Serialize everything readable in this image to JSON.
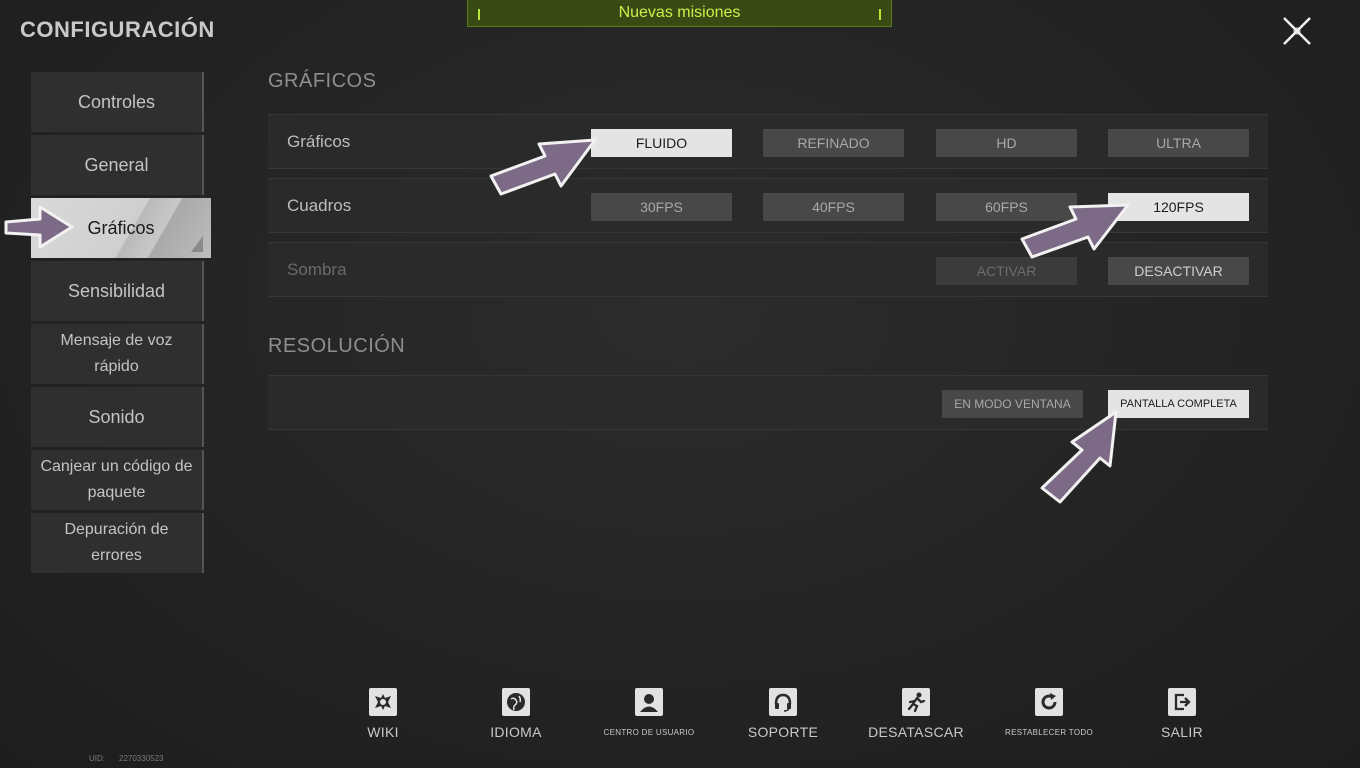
{
  "page": {
    "title": "CONFIGURACIÓN"
  },
  "banner": {
    "text": "Nuevas misiones"
  },
  "sidebar": {
    "items": [
      {
        "label": "Controles"
      },
      {
        "label": "General"
      },
      {
        "label": "Gráficos"
      },
      {
        "label": "Sensibilidad"
      },
      {
        "label": "Mensaje de voz rápido"
      },
      {
        "label": "Sonido"
      },
      {
        "label": "Canjear un código de paquete"
      },
      {
        "label": "Depuración de errores"
      }
    ],
    "active": "Gráficos"
  },
  "graphics_section": {
    "title": "GRÁFICOS",
    "rows": [
      {
        "label": "Gráficos",
        "options": [
          "FLUIDO",
          "REFINADO",
          "HD",
          "ULTRA"
        ],
        "selected": "FLUIDO"
      },
      {
        "label": "Cuadros",
        "options": [
          "30FPS",
          "40FPS",
          "60FPS",
          "120FPS"
        ],
        "selected": "120FPS"
      },
      {
        "label": "Sombra",
        "options": [
          "ACTIVAR",
          "DESACTIVAR"
        ],
        "selected": "DESACTIVAR",
        "disabled": true
      }
    ]
  },
  "resolution_section": {
    "title": "RESOLUCIÓN",
    "options": [
      "EN MODO VENTANA",
      "PANTALLA COMPLETA"
    ],
    "selected": "PANTALLA COMPLETA"
  },
  "toolbar": {
    "items": [
      {
        "label": "WIKI",
        "icon": "wiki-emblem-icon"
      },
      {
        "label": "IDIOMA",
        "icon": "globe-icon"
      },
      {
        "label": "CENTRO DE USUARIO",
        "icon": "user-icon"
      },
      {
        "label": "SOPORTE",
        "icon": "headset-icon"
      },
      {
        "label": "DESATASCAR",
        "icon": "running-person-icon"
      },
      {
        "label": "RESTABLECER TODO",
        "icon": "refresh-icon"
      },
      {
        "label": "SALIR",
        "icon": "exit-icon"
      }
    ]
  },
  "footer": {
    "uid_label": "UID:",
    "uid_value": "2270330523"
  },
  "colors": {
    "accent_banner": "#3a4a14",
    "banner_text": "#c9f04a",
    "selected_option": "#e4e4e4",
    "annotation_arrow": "#7d6a87"
  }
}
